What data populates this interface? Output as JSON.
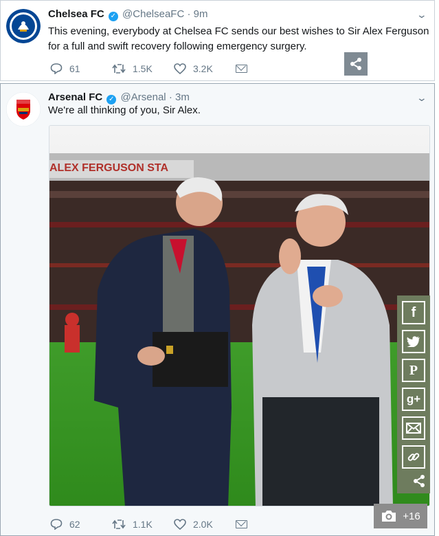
{
  "tweets": [
    {
      "name": "Chelsea FC",
      "handle": "@ChelseaFC",
      "dot": "·",
      "time": "9m",
      "text": "This evening, everybody at Chelsea FC sends our best wishes to Sir Alex Ferguson for a full and swift recovery following emergency surgery.",
      "replies": "61",
      "retweets": "1.5K",
      "likes": "3.2K",
      "avatar_color": "#034694"
    },
    {
      "name": "Arsenal FC",
      "handle": "@Arsenal",
      "dot": "·",
      "time": "3m",
      "text": "We're all thinking of you, Sir Alex.",
      "replies": "62",
      "retweets": "1.1K",
      "likes": "2.0K",
      "avatar_color": "#db0007",
      "photo": {
        "banner_text": "ALEX FERGUSON STA",
        "description_icon": "photo-of-two-men-on-football-pitch"
      }
    }
  ],
  "verified_icon": "✓",
  "social": {
    "facebook": "f",
    "googleplus": "g+",
    "pinterest": "P"
  },
  "photo_count": "+16",
  "colors": {
    "twitter_blue": "#1da1f2",
    "muted_text": "#657786",
    "share_bar": "#6e7c5e"
  }
}
